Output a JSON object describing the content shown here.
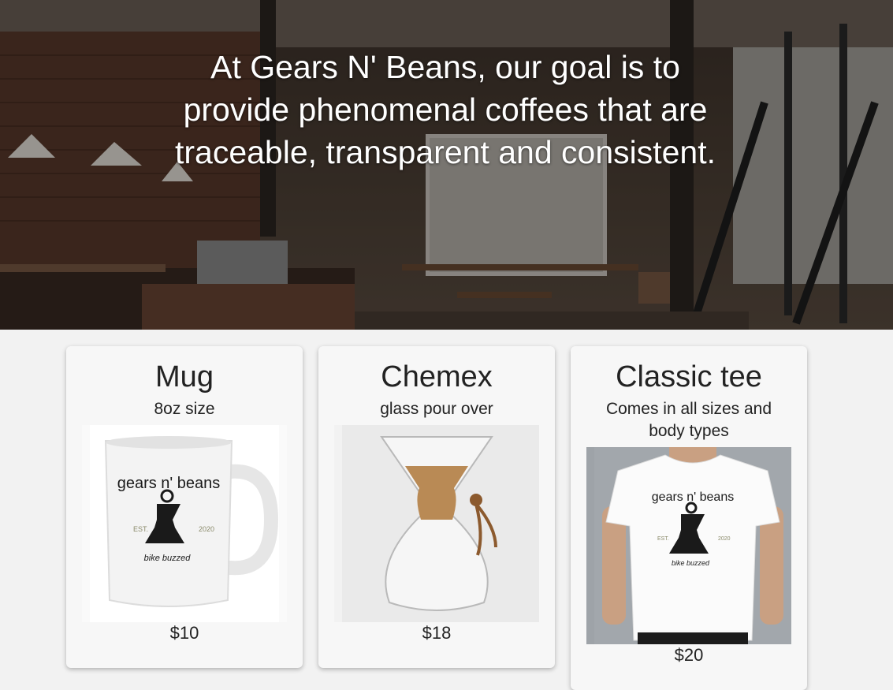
{
  "hero": {
    "statement": "At Gears N' Beans, our goal is to provide phenomenal coffees that are traceable, transparent and consistent."
  },
  "products": [
    {
      "title": "Mug",
      "subtitle": "8oz size",
      "price": "$10",
      "image_icon": "mug-icon"
    },
    {
      "title": "Chemex",
      "subtitle": "glass pour over",
      "price": "$18",
      "image_icon": "chemex-icon"
    },
    {
      "title": "Classic tee",
      "subtitle": "Comes in all sizes and body types",
      "price": "$20",
      "image_icon": "tshirt-icon"
    }
  ],
  "logo": {
    "top": "gears n' beans",
    "left": "EST.",
    "right": "2020",
    "bottom": "bike buzzed"
  }
}
